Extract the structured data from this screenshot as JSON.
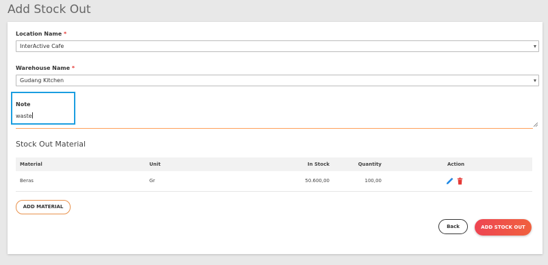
{
  "page": {
    "title": "Add Stock Out"
  },
  "form": {
    "location": {
      "label": "Location Name",
      "required_mark": "*",
      "value": "InterActive Cafe"
    },
    "warehouse": {
      "label": "Warehouse Name",
      "required_mark": "*",
      "value": "Gudang Kitchen"
    },
    "note": {
      "label": "Note",
      "value": "waste"
    }
  },
  "material_section": {
    "title": "Stock Out Material",
    "columns": [
      "Material",
      "Unit",
      "In Stock",
      "Quantity",
      "Action"
    ],
    "rows": [
      {
        "material": "Beras",
        "unit": "Gr",
        "in_stock": "50.600,00",
        "quantity": "100,00"
      }
    ],
    "add_button": "ADD MATERIAL"
  },
  "actions": {
    "back": "Back",
    "submit": "ADD STOCK OUT"
  },
  "colors": {
    "accent": "#ff9e57",
    "highlight": "#1a9de0",
    "primary": "#ef4444",
    "edit_icon": "#1e88e5",
    "delete_icon": "#e53935"
  },
  "icons": {
    "edit": "pencil-icon",
    "delete": "trash-icon",
    "dropdown": "caret-down-icon"
  }
}
